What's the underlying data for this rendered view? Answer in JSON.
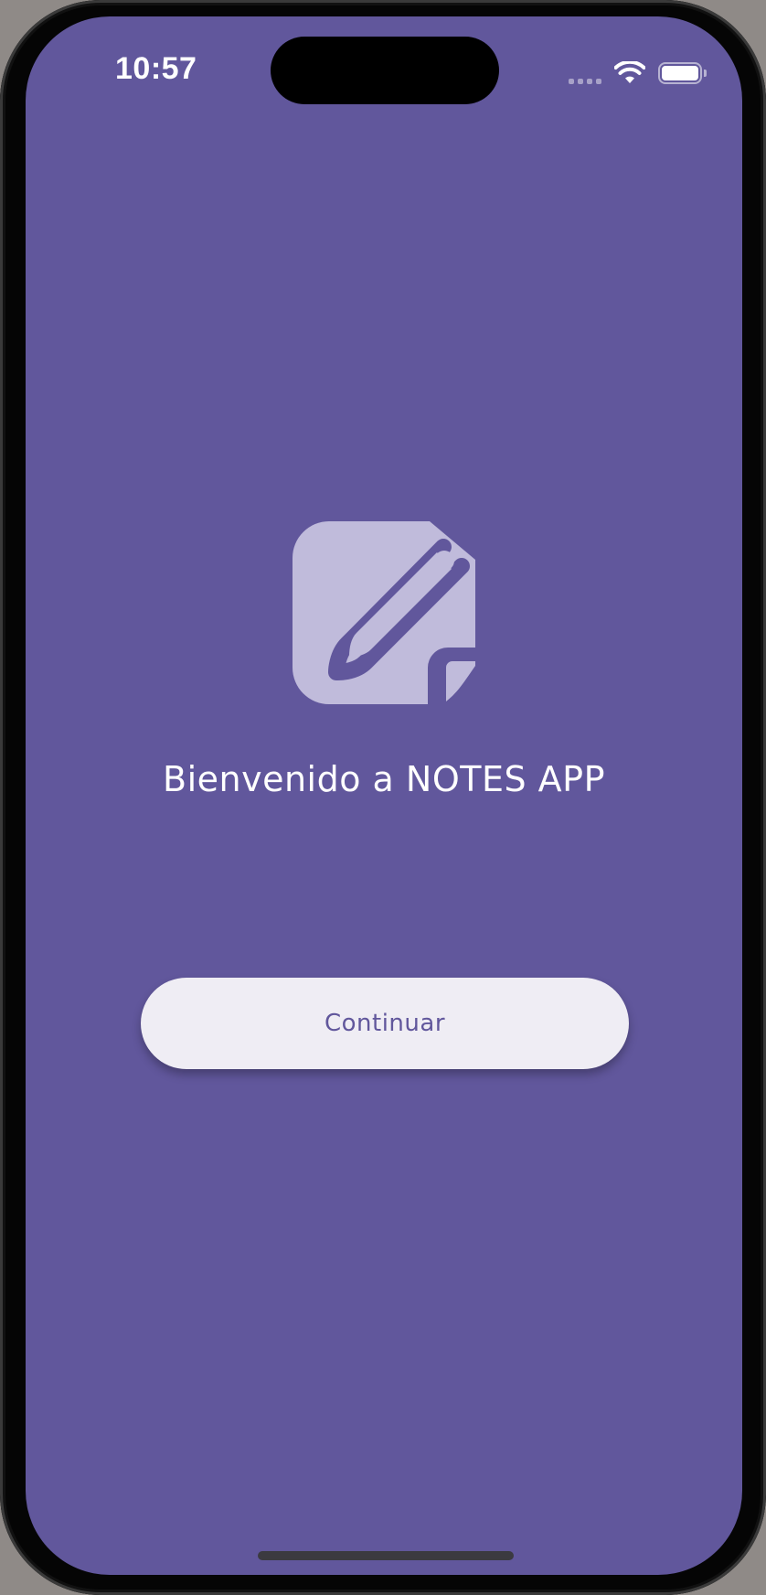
{
  "status_bar": {
    "time": "10:57",
    "icons": [
      "cellular-signal-icon",
      "wifi-icon",
      "battery-icon"
    ]
  },
  "welcome": {
    "logo_icon": "note-edit-icon",
    "title": "Bienvenido a NOTES APP"
  },
  "actions": {
    "continue_label": "Continuar"
  },
  "colors": {
    "background": "#61579c",
    "button_background": "#efedf4",
    "button_text": "#61579c",
    "logo": "#c0bbdb"
  }
}
